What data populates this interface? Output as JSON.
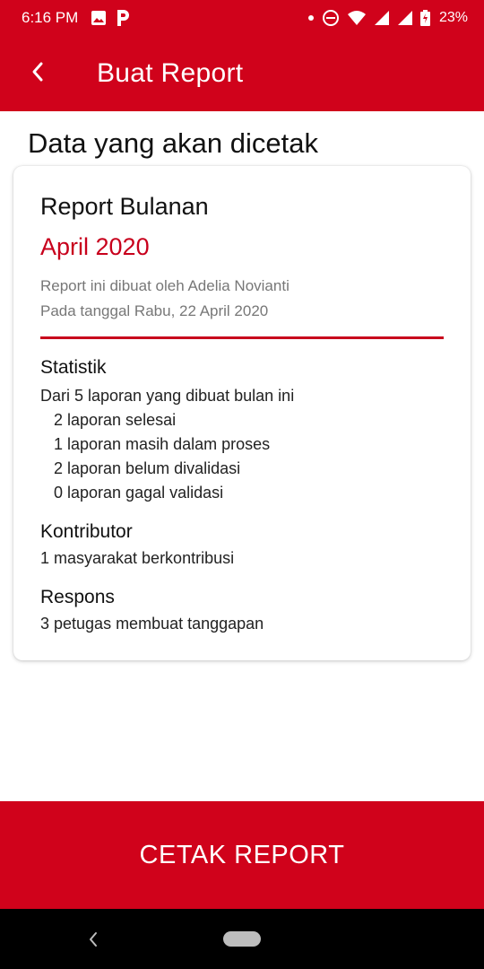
{
  "status_bar": {
    "time": "6:16 PM",
    "battery": "23%",
    "icons": [
      "image-icon",
      "parking-icon",
      "dot-icon",
      "do-not-disturb-icon",
      "wifi-icon",
      "signal-icon",
      "signal-icon",
      "battery-charging-icon"
    ]
  },
  "app_bar": {
    "back_icon": "arrow-back-icon",
    "title": "Buat Report"
  },
  "section_title": "Data yang akan dicetak",
  "report": {
    "title": "Report Bulanan",
    "period": "April 2020",
    "created_by": "Report ini dibuat oleh Adelia Novianti",
    "created_on": "Pada tanggal Rabu, 22 April 2020"
  },
  "statistik": {
    "heading": "Statistik",
    "summary": "Dari 5 laporan yang dibuat bulan ini",
    "items": [
      "2 laporan selesai",
      "1 laporan masih dalam proses",
      "2 laporan belum divalidasi",
      "0 laporan gagal validasi"
    ]
  },
  "kontributor": {
    "heading": "Kontributor",
    "text": "1 masyarakat berkontribusi"
  },
  "respons": {
    "heading": "Respons",
    "text": "3 petugas membuat tanggapan"
  },
  "action": {
    "print_label": "CETAK REPORT"
  },
  "colors": {
    "primary": "#d0021b",
    "accent_text": "#c8001c",
    "muted_text": "#777777"
  }
}
